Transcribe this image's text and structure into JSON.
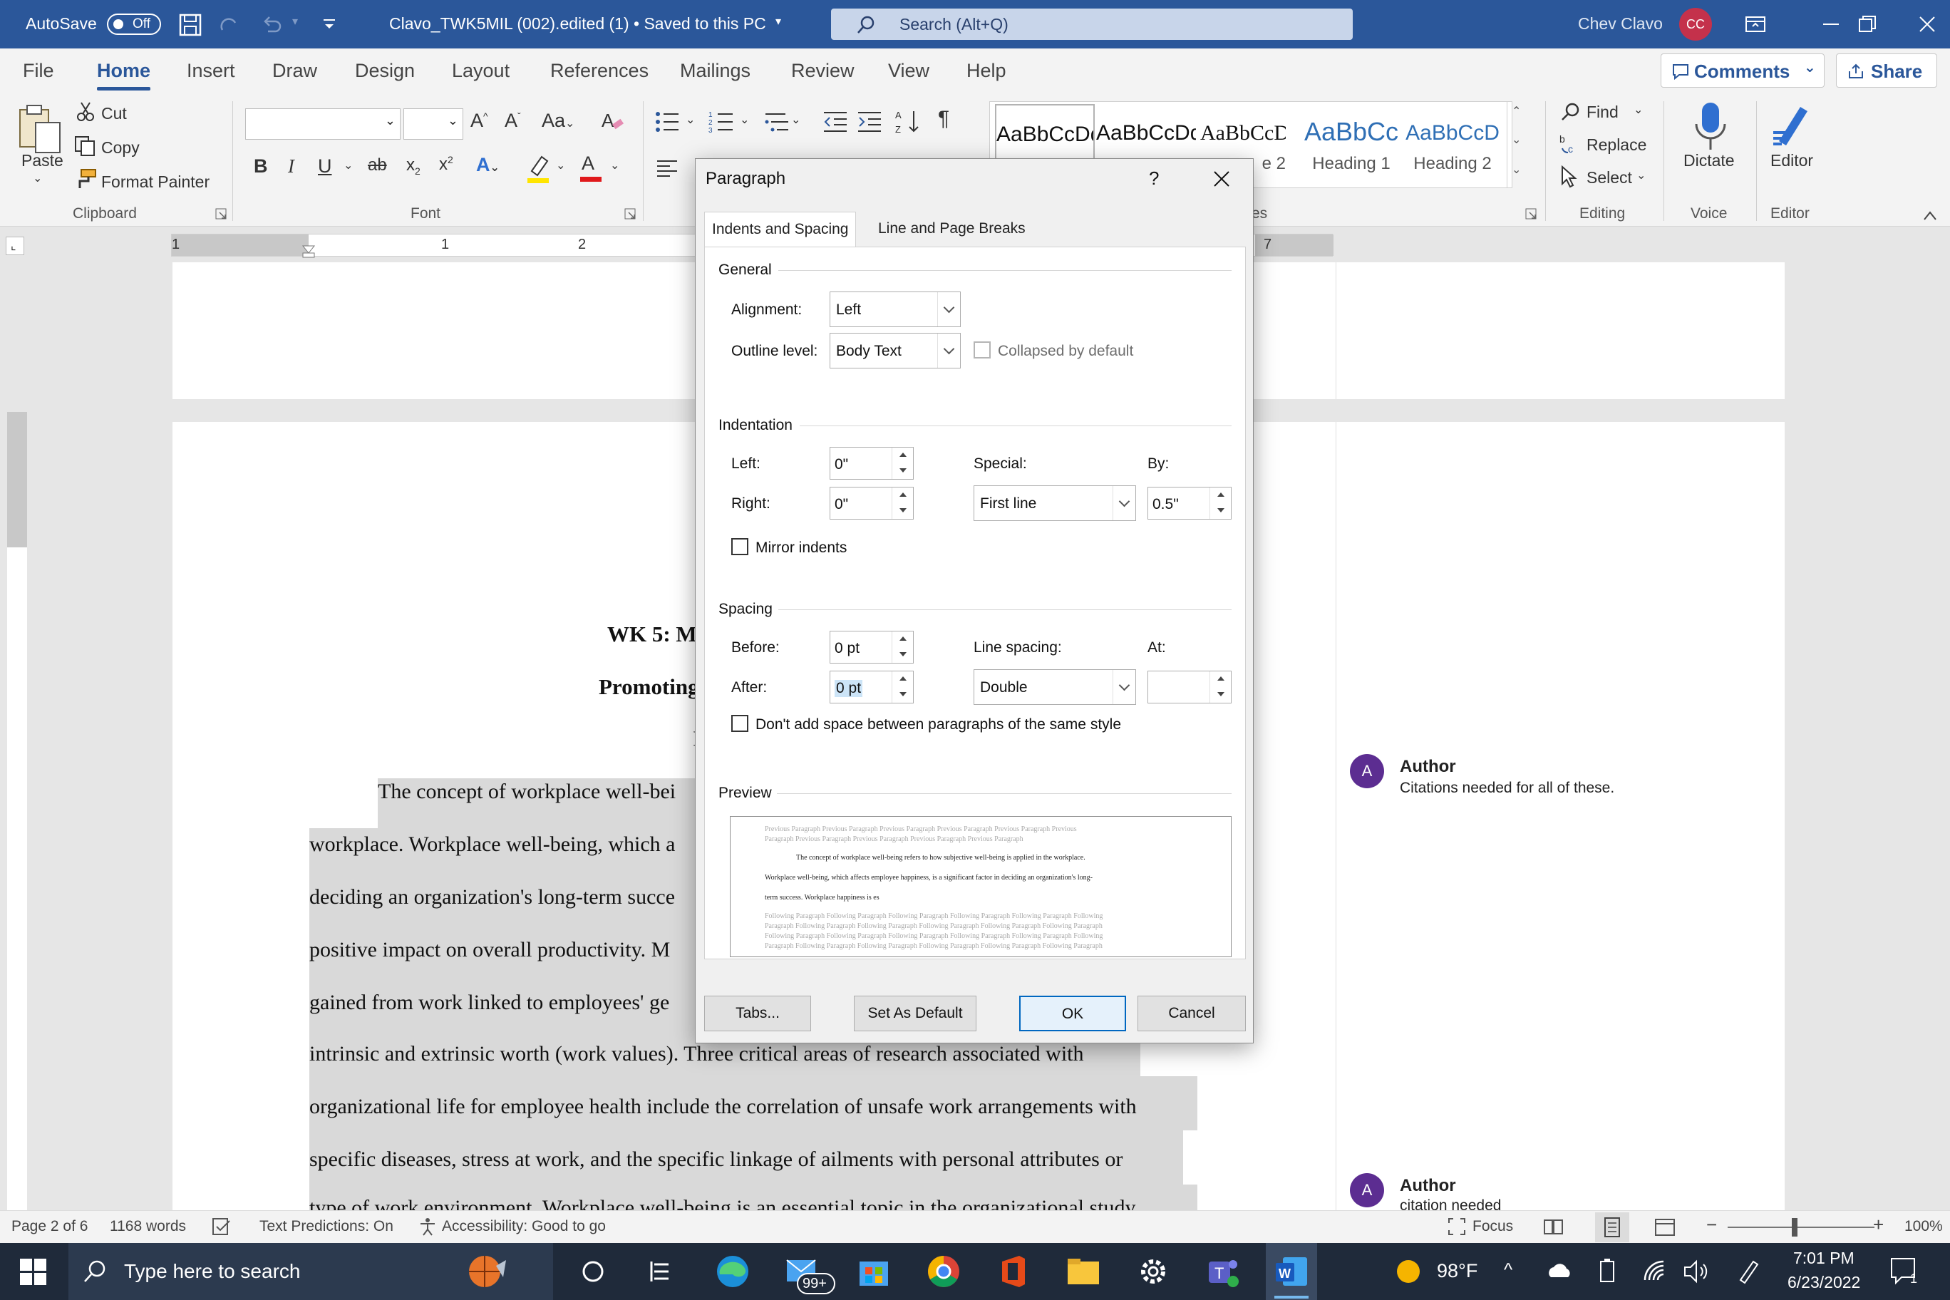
{
  "titlebar": {
    "autosave_label": "AutoSave",
    "autosave_state": "Off",
    "doc_title": "Clavo_TWK5MIL (002).edited (1) • Saved to this PC",
    "search_placeholder": "Search (Alt+Q)",
    "user_name": "Chev Clavo",
    "user_initials": "CC"
  },
  "ribbon_tabs": [
    "File",
    "Home",
    "Insert",
    "Draw",
    "Design",
    "Layout",
    "References",
    "Mailings",
    "Review",
    "View",
    "Help"
  ],
  "ribbon_actions": {
    "comments": "Comments",
    "share": "Share"
  },
  "clipboard": {
    "paste": "Paste",
    "cut": "Cut",
    "copy": "Copy",
    "format_painter": "Format Painter",
    "group": "Clipboard"
  },
  "font": {
    "group": "Font"
  },
  "styles": {
    "items": [
      {
        "preview": "AaBbCcDd",
        "name": ""
      },
      {
        "preview": "AaBbCcDd",
        "name": ""
      },
      {
        "preview": "AaBbCcD",
        "name": "e 2"
      },
      {
        "preview": "AaBbCc",
        "name": "Heading 1"
      },
      {
        "preview": "AaBbCcD",
        "name": "Heading 2"
      }
    ],
    "group_suffix": "es"
  },
  "editing": {
    "find": "Find",
    "replace": "Replace",
    "select": "Select",
    "group": "Editing"
  },
  "voice": {
    "dictate": "Dictate",
    "group": "Voice"
  },
  "editor": {
    "editor": "Editor",
    "group": "Editor"
  },
  "ruler": {
    "marks": [
      "1",
      "1",
      "2",
      "7"
    ]
  },
  "document": {
    "title_partial": "WK 5: M",
    "subtitle_partial": "Promoting",
    "small_partial": "I",
    "lines": [
      "The concept of workplace well-bei",
      "workplace. Workplace well-being, which a",
      "deciding an organization's long-term succe",
      "positive impact on overall productivity. M",
      "gained from work linked to employees' ge",
      "intrinsic and extrinsic worth (work values). Three critical areas of research associated with",
      "organizational life for employee health include the correlation of unsafe work arrangements with",
      "specific diseases, stress at work, and the specific linkage of ailments with personal attributes or",
      "type of work environment. Workplace well-being is an essential topic in the organizational study"
    ]
  },
  "comments": [
    {
      "initial": "A",
      "author": "Author",
      "text": "Citations needed for all of these."
    },
    {
      "initial": "A",
      "author": "Author",
      "text": "citation needed"
    }
  ],
  "dialog": {
    "title": "Paragraph",
    "help": "?",
    "tabs": [
      "Indents and Spacing",
      "Line and Page Breaks"
    ],
    "general": {
      "label": "General",
      "alignment_label": "Alignment:",
      "alignment_value": "Left",
      "outline_label": "Outline level:",
      "outline_value": "Body Text",
      "collapsed_label": "Collapsed by default"
    },
    "indentation": {
      "label": "Indentation",
      "left_label": "Left:",
      "left_value": "0\"",
      "right_label": "Right:",
      "right_value": "0\"",
      "special_label": "Special:",
      "special_value": "First line",
      "by_label": "By:",
      "by_value": "0.5\"",
      "mirror_label": "Mirror indents"
    },
    "spacing": {
      "label": "Spacing",
      "before_label": "Before:",
      "before_value": "0 pt",
      "after_label": "After:",
      "after_value": "0 pt",
      "line_spacing_label": "Line spacing:",
      "line_spacing_value": "Double",
      "at_label": "At:",
      "at_value": "",
      "dont_add_label": "Don't add space between paragraphs of the same style"
    },
    "preview": {
      "label": "Preview",
      "prev_lines": [
        "Previous Paragraph Previous Paragraph Previous Paragraph Previous Paragraph Previous Paragraph Previous",
        "Paragraph Previous Paragraph Previous Paragraph Previous Paragraph Previous Paragraph"
      ],
      "sample_lines": [
        "The concept of workplace well-being refers to how subjective well-being is applied in the workplace.",
        "Workplace well-being, which affects employee happiness, is a significant factor in deciding an organization's long-",
        "term success. Workplace happiness is es"
      ],
      "follow_lines": [
        "Following Paragraph Following Paragraph Following Paragraph Following Paragraph Following Paragraph Following",
        "Paragraph Following Paragraph Following Paragraph Following Paragraph Following Paragraph Following Paragraph",
        "Following Paragraph Following Paragraph Following Paragraph Following Paragraph Following Paragraph Following",
        "Paragraph Following Paragraph Following Paragraph Following Paragraph Following Paragraph Following Paragraph"
      ]
    },
    "buttons": {
      "tabs": "Tabs...",
      "set_default": "Set As Default",
      "ok": "OK",
      "cancel": "Cancel"
    }
  },
  "statusbar": {
    "page": "Page 2 of 6",
    "words": "1168 words",
    "text_predictions": "Text Predictions: On",
    "accessibility": "Accessibility: Good to go",
    "focus": "Focus",
    "zoom": "100%"
  },
  "taskbar": {
    "search_placeholder": "Type here to search",
    "mail_badge": "99+",
    "weather": "98°F",
    "time": "7:01 PM",
    "date": "6/23/2022",
    "notif_count": "1"
  }
}
